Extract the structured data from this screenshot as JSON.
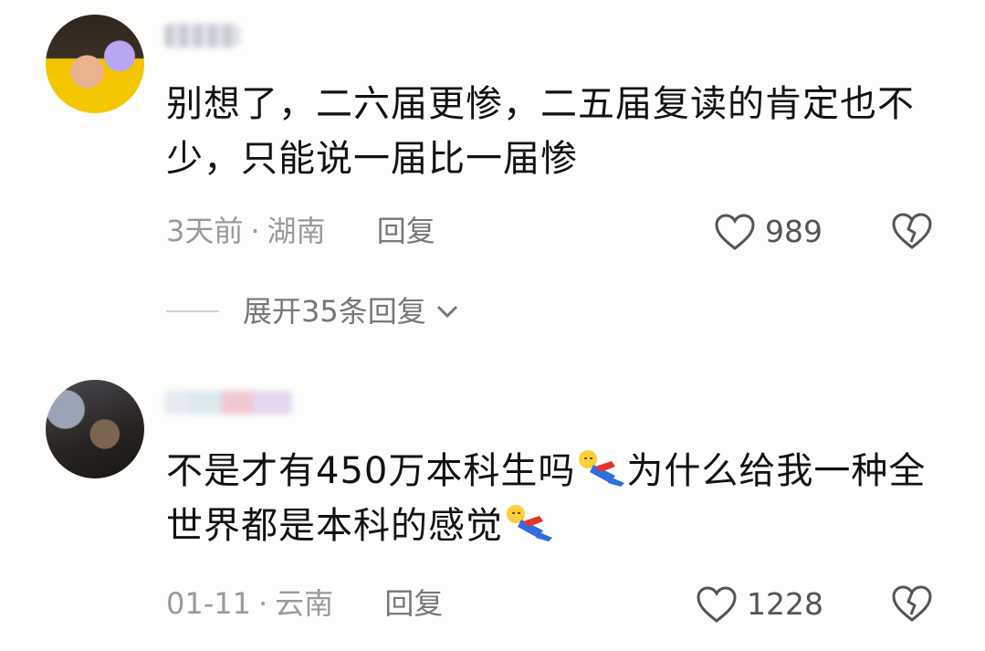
{
  "comments": [
    {
      "username": "▓▓▓▓",
      "text_parts": [
        "别想了，二六届更惨，二五届复读的肯定也不少，只能说一届比一届惨"
      ],
      "time": "3天前",
      "separator": "·",
      "location": "湖南",
      "reply_label": "回复",
      "likes": "989",
      "expand_label": "展开35条回复"
    },
    {
      "username": "▓▓▓▓▓▓",
      "text_parts": [
        "不是才有450万本科生吗",
        "为什么给我一种全世界都是本科的感觉"
      ],
      "time": "01-11",
      "separator": "·",
      "location": "云南",
      "reply_label": "回复",
      "likes": "1228"
    }
  ],
  "icons": {
    "like": "heart-outline-icon",
    "dislike": "broken-heart-icon",
    "expand": "chevron-down-icon",
    "emoji": "lying-down-emoji"
  },
  "colors": {
    "text": "#121212",
    "meta": "#9a9a9a",
    "icon": "#555555"
  }
}
